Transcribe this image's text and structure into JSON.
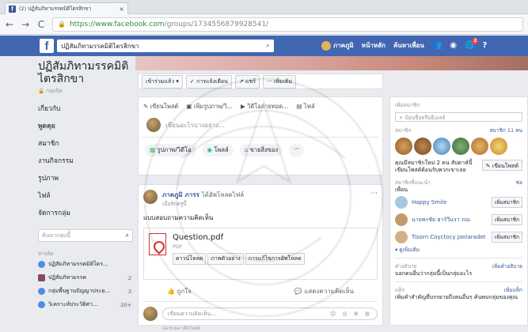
{
  "browser": {
    "tab_title": "(2) ปฏิสัมภิทามรรคมิติไตรสิกขา",
    "tab_close": "×",
    "back": "←",
    "forward": "→",
    "reload": "C",
    "url_host": "https://www.facebook.com",
    "url_path": "/groups/1734556879928541/"
  },
  "fb_header": {
    "logo": "f",
    "search_value": "ปฏิสัมภิทามรรคมิติไตรสิกขา",
    "user_name": "ภาคภูมิ",
    "home": "หน้าหลัก",
    "find_friends": "ค้นหาเพื่อน",
    "notif_count": "2"
  },
  "left": {
    "group_name": "ปฏิสัมภิทามรรคมิติไตรสิกขา",
    "group_type": "กลุ่มปิด",
    "nav": [
      "เกี่ยวกับ",
      "พูดคุย",
      "สมาชิก",
      "งานกิจกรรม",
      "รูปภาพ",
      "ไฟล์",
      "จัดการกลุ่ม"
    ],
    "search_placeholder": "ค้นหากลุ่มนี้",
    "shortcuts_label": "ทางลัด",
    "shortcuts": [
      {
        "name": "ปฏิสัมภิทามรรคมิติไตร...",
        "count": ""
      },
      {
        "name": "ปฏิสัมภิทามรรค",
        "count": "2"
      },
      {
        "name": "กลุ่มพื้นฐานปัญญาประย...",
        "count": "3"
      },
      {
        "name": "วิเคราะห์ประวัติศา...",
        "count": "20+"
      }
    ]
  },
  "toolbar": {
    "joined": "เข้าร่วมแล้ว ▾",
    "notifications": "✓ การแจ้งเตือน",
    "share": "↗ แชร์",
    "more": "··· เพิ่มเติม"
  },
  "composer": {
    "tab_write": "เขียนโพสต์",
    "tab_photo": "เพิ่มรูปภาพ/วิ...",
    "tab_live": "วิดีโอถ่ายทอด...",
    "tab_files": "ไฟล์",
    "placeholder": "เขียนอะไรบางอย่าง...",
    "photo_video": "รูปภาพ/วิดีโอ",
    "poll": "โพลล์",
    "sell": "ขายสิ่งของ",
    "more": "···"
  },
  "post": {
    "author": "ภาคภูมิ ภารร",
    "action": "ได้อัพโหลดไฟล์",
    "time": "เมื่อสักครู่นี้",
    "more": "···",
    "text": "แบบสอบถามความคิดเห็น",
    "file_name": "Question.pdf",
    "file_type": "PDF",
    "btn_download": "ดาวน์โหลด",
    "btn_preview": "ภาพตัวอย่าง",
    "btn_upload": "การแก้ไขการอัพโหลด",
    "like": "ถูกใจ",
    "comment": "แสดงความคิดเห็น",
    "comment_placeholder": "เขียนความคิดเห็น...",
    "emojis": "☺ ◎ ⊕ ◍",
    "hint": "กด Enter เพื่อโพสต์"
  },
  "right": {
    "add_members_title": "เพิ่มสมาชิก",
    "add_members_placeholder": "+ ป้อนชื่อหรืออีเมลล์",
    "members_title": "สมาชิก",
    "members_count": "สมาชิก 11 คน",
    "new_members_text": "คุณมีสมาชิกใหม่ 2 คน สัปดาห์นี้ เขียนโพสต์ต้อนรับพวกเขาเลย",
    "welcome_btn": "✎ เขียนโพสต์",
    "suggested_title": "สมาชิกที่แนะนำ",
    "suggested_more": "ซ่อ",
    "friends_label": "เพื่อน",
    "suggested": [
      {
        "name": "Happy Smile",
        "btn": "เพิ่มสมาชิก"
      },
      {
        "name": "นายพรชัย ฮาร์วีนรา ภณ",
        "btn": "เพิ่มสมาชิก"
      },
      {
        "name": "Tisorn Coyctocy Janlaradet",
        "btn": "เพิ่มสมาชิก"
      }
    ],
    "see_more": "▾ ดูเพิ่มเติม",
    "desc_title": "คำอธิบาย",
    "desc_link": "เพิ่มคำอธิบาย",
    "desc_text": "บอกคนอื่นว่ากลุ่มนี้เป็นกลุ่มอะไร",
    "tags_title": "แท็ก",
    "tags_link": "เพิ่มแท็ก",
    "tags_text": "เพิ่มคำสำคัญที่บรรยายถึงคนอื่นๆ ค้นพบกลุ่มของคุณ"
  }
}
